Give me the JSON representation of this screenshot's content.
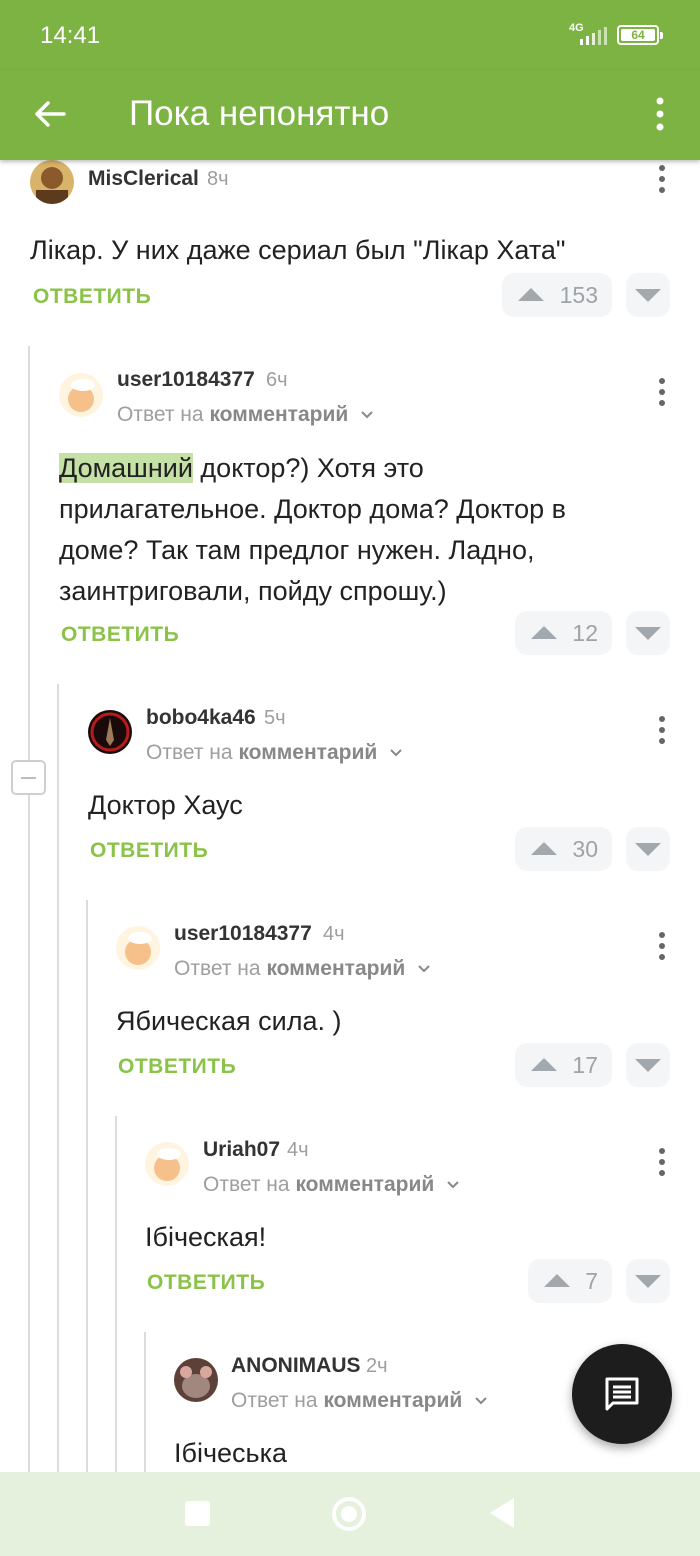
{
  "status_bar": {
    "time": "14:41",
    "network": "4G",
    "battery": "64"
  },
  "app_bar": {
    "title": "Пока непонятно",
    "back_icon": "arrow-left-icon",
    "menu_icon": "more-vert-icon"
  },
  "colors": {
    "brand_green": "#7cb342",
    "reply_green": "#8bc34a",
    "highlight": "#c5e1a5",
    "nav_bg": "#e5f1dc"
  },
  "comments": [
    {
      "author": "MisClerical",
      "ago": "8ч",
      "reply_to": "",
      "text": "Лікар. У них даже сериал был \"Лікар Хата\"",
      "votes": "153",
      "reply_label": "ОТВЕТИТЬ"
    },
    {
      "author": "user10184377",
      "ago": "6ч",
      "reply_prefix": "Ответ на",
      "reply_target": "комментарий",
      "text_highlight": "Домашний",
      "text": " доктор?) Хотя это прилагательное. Доктор дома? Доктор в доме? Так там предлог нужен. Ладно, заинтриговали, пойду спрошу.)",
      "votes": "12",
      "reply_label": "ОТВЕТИТЬ"
    },
    {
      "author": "bobo4ka46",
      "ago": "5ч",
      "reply_prefix": "Ответ на",
      "reply_target": "комментарий",
      "text": "Доктор Хаус",
      "votes": "30",
      "reply_label": "ОТВЕТИТЬ"
    },
    {
      "author": "user10184377",
      "ago": "4ч",
      "reply_prefix": "Ответ на",
      "reply_target": "комментарий",
      "text": "Ябическая сила. )",
      "votes": "17",
      "reply_label": "ОТВЕТИТЬ"
    },
    {
      "author": "Uriah07",
      "ago": "4ч",
      "reply_prefix": "Ответ на",
      "reply_target": "комментарий",
      "text": "Ібіческая!",
      "votes": "7",
      "reply_label": "ОТВЕТИТЬ"
    },
    {
      "author": "ANONIMAUS",
      "ago": "2ч",
      "reply_prefix": "Ответ на",
      "reply_target": "комментарий",
      "text": "Ібічеська"
    }
  ],
  "fab": {
    "icon": "comment-icon"
  },
  "nav_bar": {
    "recent_icon": "square-icon",
    "home_icon": "circle-icon",
    "back_icon": "triangle-back-icon"
  }
}
